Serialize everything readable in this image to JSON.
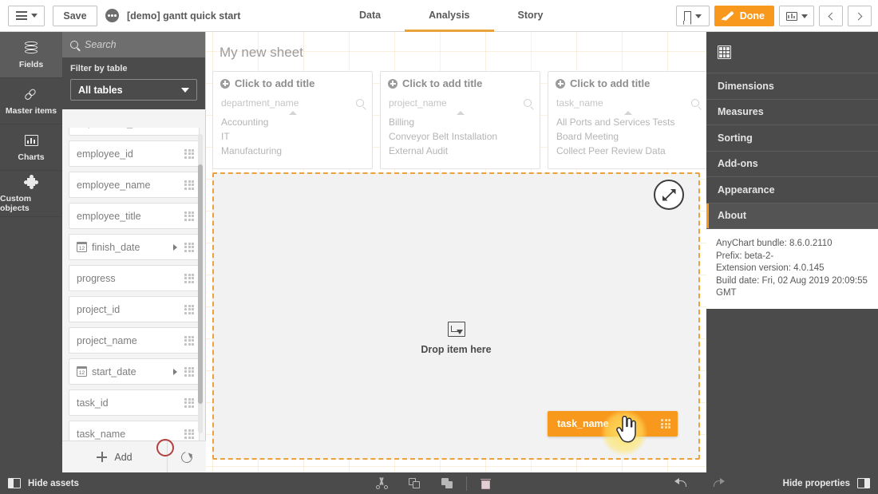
{
  "topbar": {
    "menu_icon": "hamburger-icon",
    "save_label": "Save",
    "app_title": "[demo] gantt quick start",
    "nav_tabs": [
      {
        "label": "Data",
        "active": false
      },
      {
        "label": "Analysis",
        "active": true
      },
      {
        "label": "Story",
        "active": false
      }
    ],
    "bookmark_icon": "bookmark-icon",
    "done_label": "Done",
    "edit_icon": "pencil-icon",
    "sheet_picker_icon": "chart-thumbnail-icon",
    "prev_icon": "chevron-left-icon",
    "next_icon": "chevron-right-icon"
  },
  "rail": {
    "items": [
      {
        "label": "Fields",
        "icon": "database-icon",
        "active": true
      },
      {
        "label": "Master items",
        "icon": "link-icon",
        "active": false
      },
      {
        "label": "Charts",
        "icon": "bar-chart-icon",
        "active": false
      },
      {
        "label": "Custom objects",
        "icon": "puzzle-piece-icon",
        "active": false
      }
    ]
  },
  "assets": {
    "search": {
      "placeholder": "Search",
      "value": "",
      "icon": "search-icon"
    },
    "filter_label": "Filter by table",
    "filter_value": "All tables",
    "fields": [
      {
        "name": "department_name",
        "type": "text",
        "partial": true
      },
      {
        "name": "employee_id",
        "type": "text"
      },
      {
        "name": "employee_name",
        "type": "text"
      },
      {
        "name": "employee_title",
        "type": "text"
      },
      {
        "name": "finish_date",
        "type": "date",
        "expandable": true
      },
      {
        "name": "progress",
        "type": "text"
      },
      {
        "name": "project_id",
        "type": "text"
      },
      {
        "name": "project_name",
        "type": "text"
      },
      {
        "name": "start_date",
        "type": "date",
        "expandable": true
      },
      {
        "name": "task_id",
        "type": "text"
      },
      {
        "name": "task_name",
        "type": "text",
        "highlighted": true
      }
    ],
    "add_label": "Add",
    "add_icon": "plus-icon",
    "refresh_icon": "refresh-icon"
  },
  "sheet": {
    "title": "My new sheet",
    "panes": [
      {
        "title": "Click to add title",
        "field": "department_name",
        "values": [
          "Accounting",
          "IT",
          "Manufacturing"
        ]
      },
      {
        "title": "Click to add title",
        "field": "project_name",
        "values": [
          "Billing",
          "Conveyor Belt Installation",
          "External Audit"
        ]
      },
      {
        "title": "Click to add title",
        "field": "task_name",
        "values": [
          "All Ports and Services Tests",
          "Board Meeting",
          "Collect Peer Review Data"
        ]
      }
    ],
    "expand_icon": "expand-arrows-icon",
    "dropzone": {
      "text": "Drop item here",
      "icon": "drop-item-icon"
    },
    "drag_chip": {
      "label": "task_name",
      "grip_icon": "drag-handle-icon",
      "cursor_icon": "pointing-hand-cursor"
    }
  },
  "properties": {
    "header_icon": "table-grid-icon",
    "items": [
      {
        "label": "Dimensions",
        "active": false
      },
      {
        "label": "Measures",
        "active": false
      },
      {
        "label": "Sorting",
        "active": false
      },
      {
        "label": "Add-ons",
        "active": false
      },
      {
        "label": "Appearance",
        "active": false
      },
      {
        "label": "About",
        "active": true
      }
    ],
    "about": [
      "AnyChart bundle: 8.6.0.2110",
      "Prefix: beta-2-",
      "Extension version: 4.0.145",
      "Build date: Fri, 02 Aug 2019 20:09:55 GMT"
    ]
  },
  "bottombar": {
    "hide_assets_label": "Hide assets",
    "hide_assets_icon": "panel-left-toggle-icon",
    "cut_icon": "scissors-icon",
    "copy_icon": "copy-icon",
    "duplicate_icon": "duplicate-icon",
    "paste_icon": "paste-clipboard-icon",
    "undo_icon": "undo-arrow-icon",
    "redo_icon": "redo-arrow-icon",
    "hide_properties_label": "Hide properties",
    "hide_properties_icon": "panel-right-toggle-icon"
  },
  "colors": {
    "accent_orange": "#f8981d",
    "tab_underline": "#e9a33a",
    "dark_panel": "#4b4b4b",
    "rail_active": "#5c5c5c",
    "annotation_red": "#b3403f"
  }
}
